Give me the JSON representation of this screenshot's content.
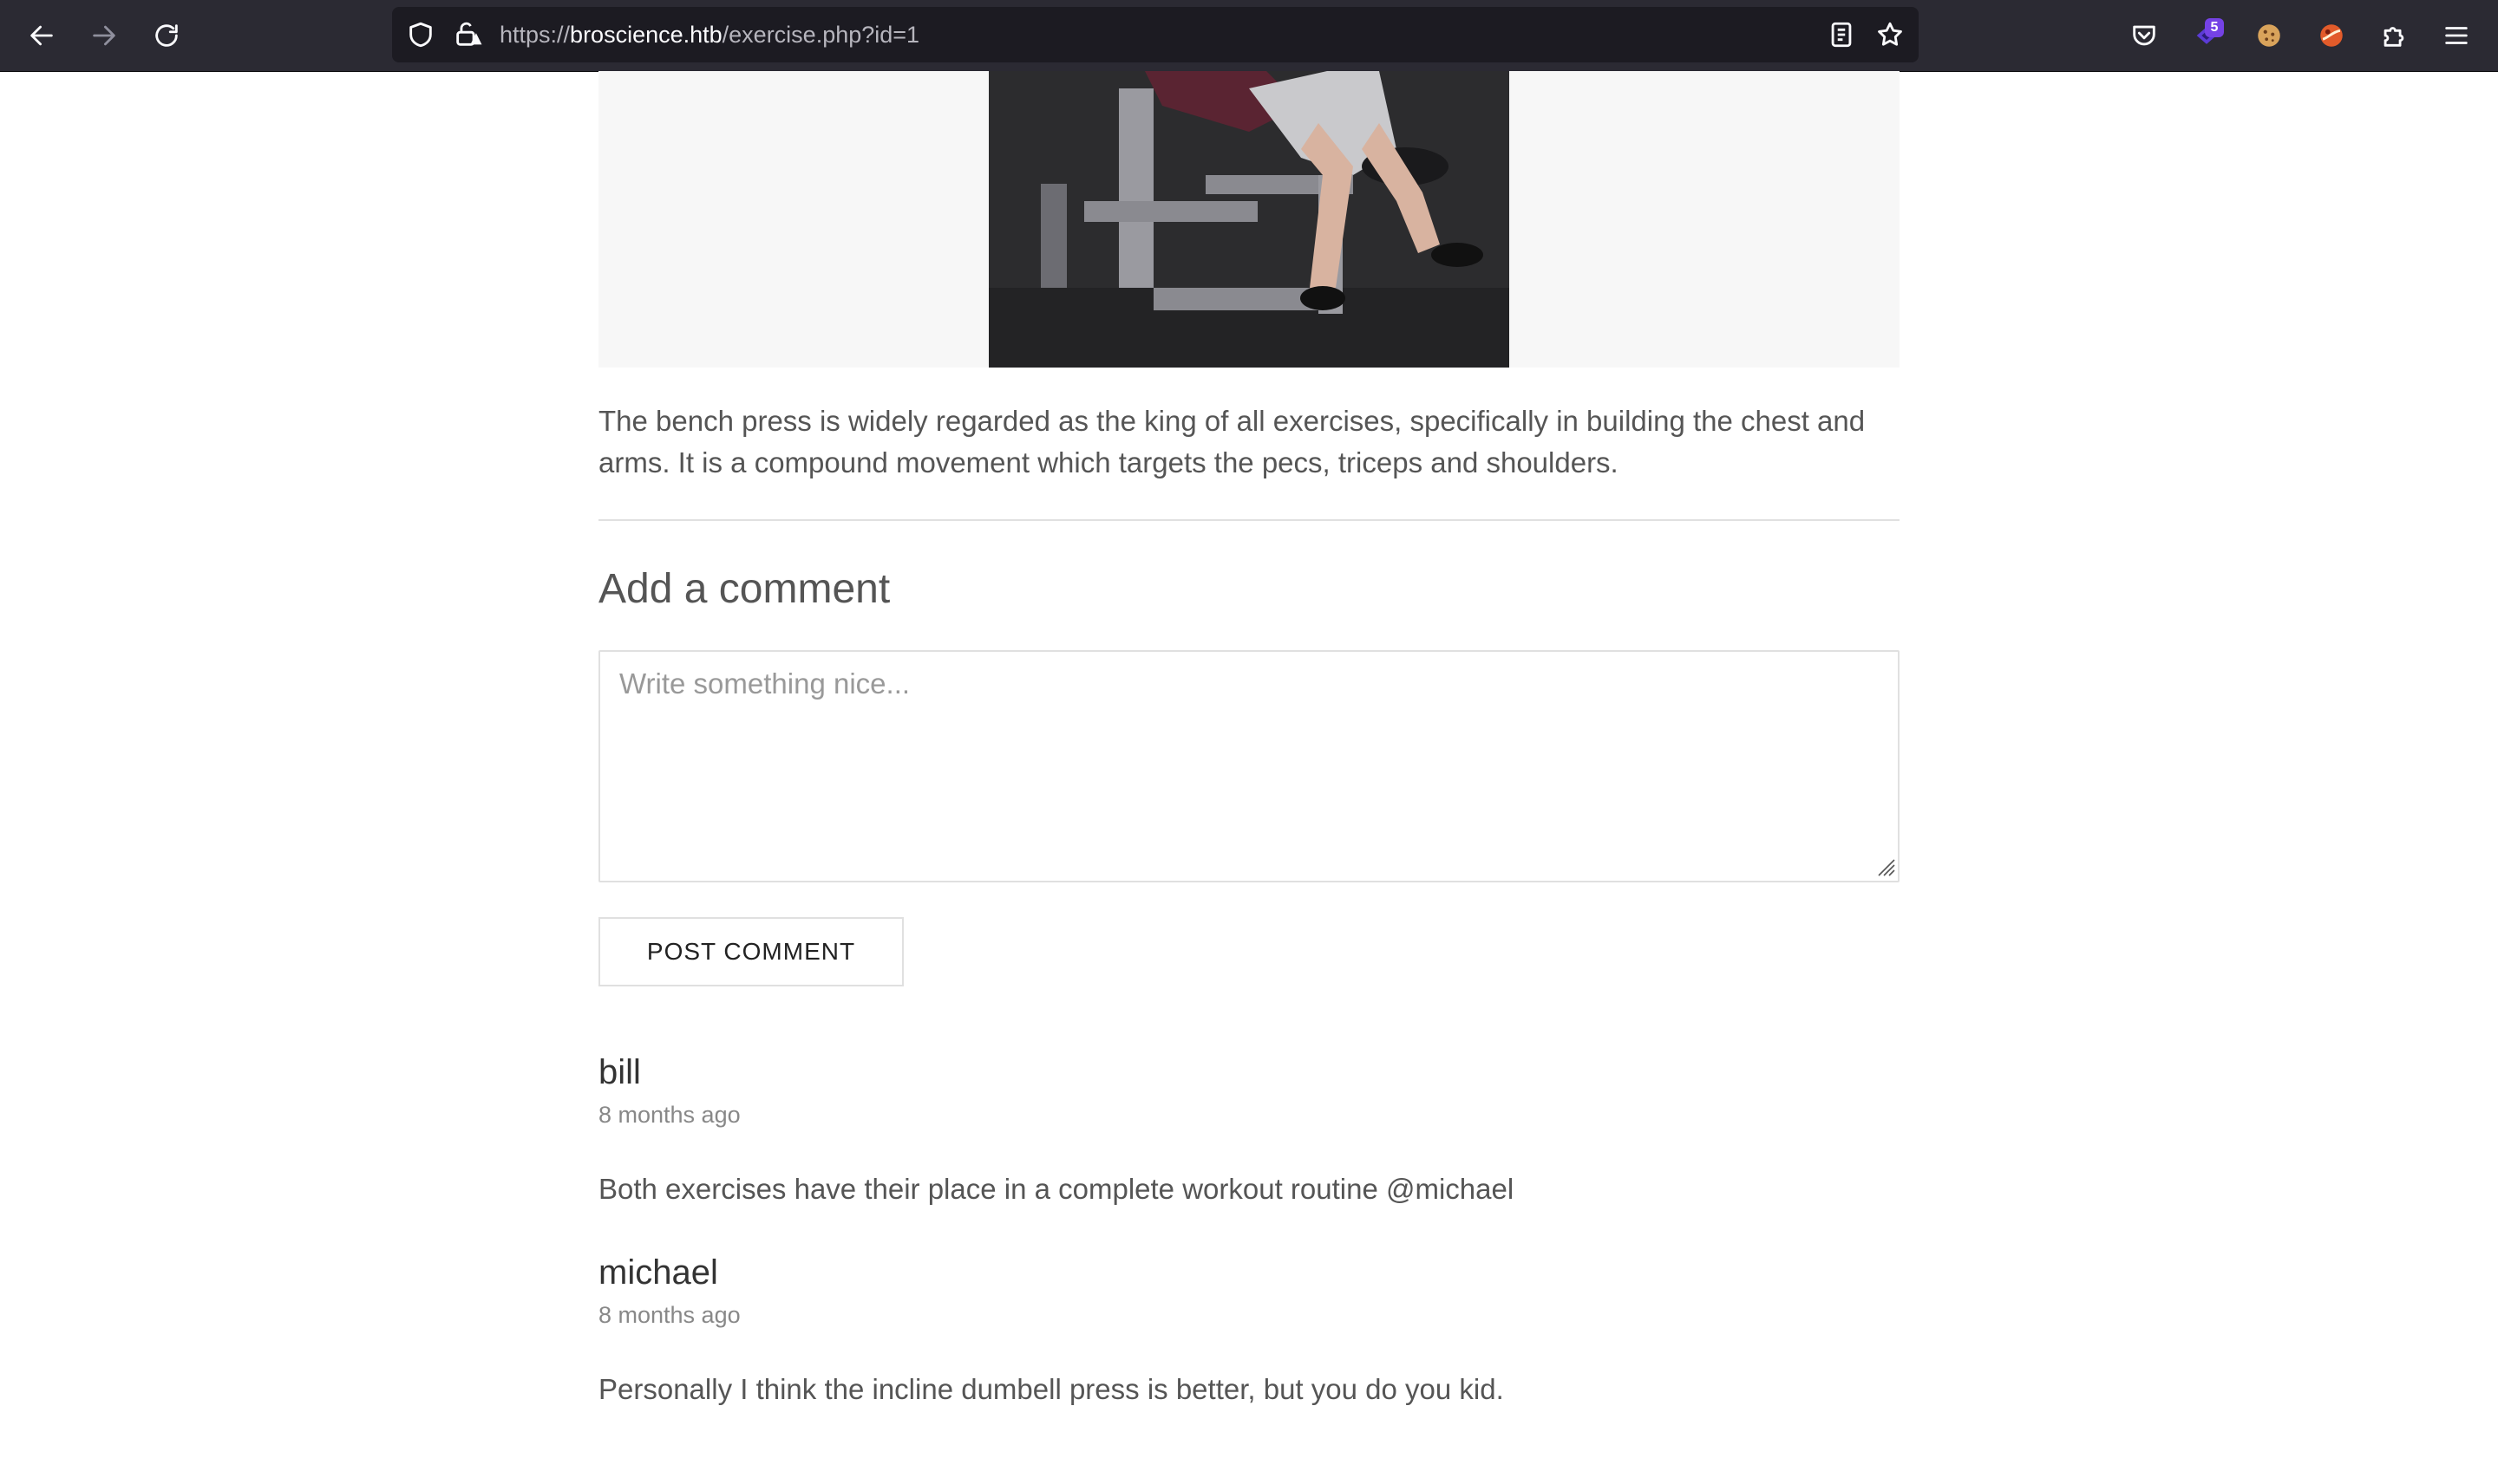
{
  "browser": {
    "url_scheme": "https://",
    "url_host": "broscience.htb",
    "url_path": "/exercise.php?id=1",
    "extension_badge_count": "5",
    "icons": {
      "back": "back-arrow-icon",
      "forward": "forward-arrow-icon",
      "reload": "reload-icon",
      "shield": "tracking-shield-icon",
      "lock": "insecure-lock-icon",
      "reader": "reader-view-icon",
      "bookmark": "bookmark-star-icon",
      "pocket": "pocket-icon",
      "extensions": [
        "extension-badge-icon",
        "cookie-icon",
        "extension-icon"
      ],
      "puzzle": "extensions-puzzle-icon",
      "menu": "hamburger-menu-icon"
    }
  },
  "exercise": {
    "image_alt": "bench press",
    "description": "The bench press is widely regarded as the king of all exercises, specifically in building the chest and arms. It is a compound movement which targets the pecs, triceps and shoulders."
  },
  "comment_form": {
    "heading": "Add a comment",
    "placeholder": "Write something nice...",
    "value": "",
    "submit_label": "POST COMMENT"
  },
  "comments": [
    {
      "author": "bill",
      "time": "8 months ago",
      "text": "Both exercises have their place in a complete workout routine @michael"
    },
    {
      "author": "michael",
      "time": "8 months ago",
      "text": "Personally I think the incline dumbell press is better, but you do you kid."
    }
  ],
  "colors": {
    "toolbar_bg": "#2b2a33",
    "urlbar_bg": "#1c1b22",
    "text": "#555555",
    "muted": "#888888",
    "border": "#e0e0e0",
    "badge": "#7542e5"
  }
}
